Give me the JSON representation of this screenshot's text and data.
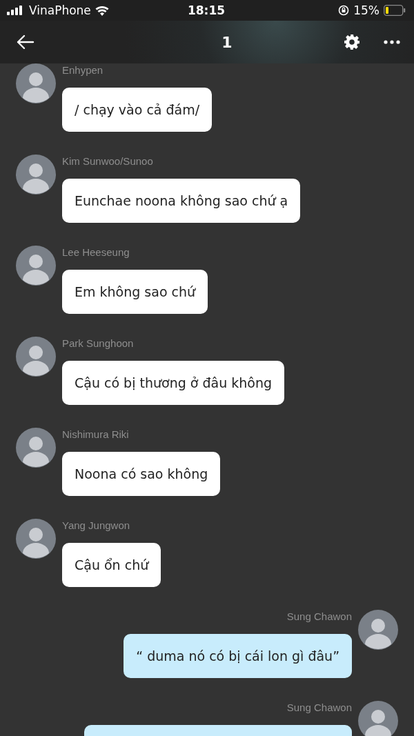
{
  "status_bar": {
    "carrier": "VinaPhone",
    "time": "18:15",
    "battery": "15%"
  },
  "header": {
    "title": "1"
  },
  "messages": [
    {
      "kind": "incoming",
      "sender": "Enhypen",
      "text": "/ chạy vào cả đám/"
    },
    {
      "kind": "incoming",
      "sender": "Kim Sunwoo/Sunoo",
      "text": "Eunchae noona không sao chứ ạ"
    },
    {
      "kind": "incoming",
      "sender": "Lee Heeseung",
      "text": "Em không sao chứ"
    },
    {
      "kind": "incoming",
      "sender": "Park Sunghoon",
      "text": "Cậu có bị thương ở đâu không"
    },
    {
      "kind": "incoming",
      "sender": "Nishimura Riki",
      "text": "Noona có sao không"
    },
    {
      "kind": "incoming",
      "sender": "Yang Jungwon",
      "text": "Cậu ổn chứ"
    },
    {
      "kind": "outgoing",
      "sender": "Sung Chawon",
      "text": "“ duma nó có bị cái lon gì đâu”"
    },
    {
      "kind": "outgoing",
      "sender": "Sung Chawon"
    }
  ]
}
